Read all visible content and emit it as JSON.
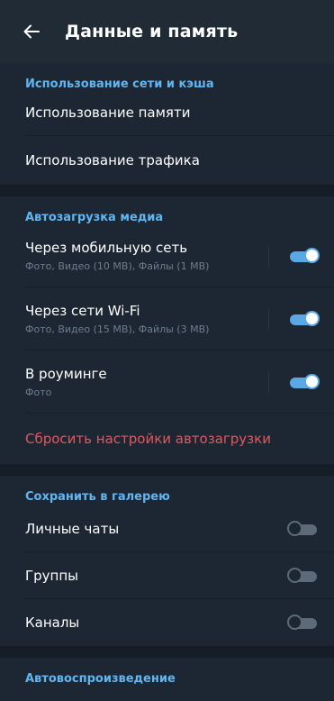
{
  "header": {
    "title": "Данные и память"
  },
  "sections": {
    "network": {
      "title": "Использование сети и кэша",
      "items": [
        {
          "label": "Использование памяти"
        },
        {
          "label": "Использование трафика"
        }
      ]
    },
    "autodownload": {
      "title": "Автозагрузка медиа",
      "items": [
        {
          "label": "Через мобильную сеть",
          "sub": "Фото, Видео (10 MB), Файлы (1 MB)",
          "enabled": true
        },
        {
          "label": "Через сети Wi-Fi",
          "sub": "Фото, Видео (15 MB), Файлы (3 MB)",
          "enabled": true
        },
        {
          "label": "В роуминге",
          "sub": "Фото",
          "enabled": true
        }
      ],
      "reset_label": "Сбросить настройки автозагрузки"
    },
    "gallery": {
      "title": "Сохранить в галерею",
      "items": [
        {
          "label": "Личные чаты",
          "enabled": false
        },
        {
          "label": "Группы",
          "enabled": false
        },
        {
          "label": "Каналы",
          "enabled": false
        }
      ]
    },
    "autoplay": {
      "title": "Автовоспроизведение"
    }
  },
  "colors": {
    "accent": "#5fb6f3",
    "danger": "#e0585d",
    "background": "#1d2733",
    "header": "#202b36"
  },
  "icons": {
    "back": "arrow-left-icon"
  }
}
